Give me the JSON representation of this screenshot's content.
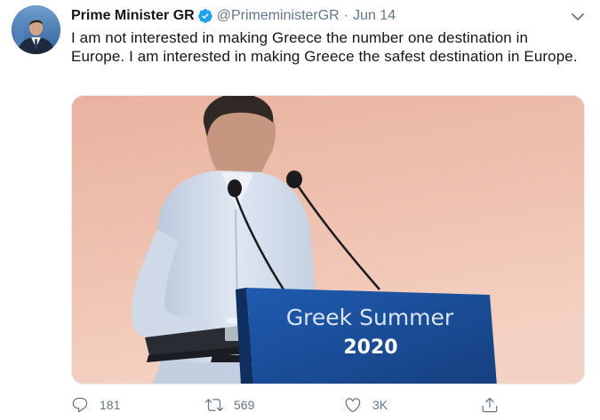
{
  "author": {
    "display_name": "Prime Minister GR",
    "handle": "@PrimeministerGR",
    "separator": "·",
    "date": "Jun 14",
    "verified": true
  },
  "tweet": {
    "text": "I am not interested in making Greece the number one destination in Europe. I am interested in making Greece the safest destination in Europe."
  },
  "media": {
    "podium_line1": "Greek Summer",
    "podium_line2": "2020"
  },
  "actions": {
    "reply_count": "181",
    "retweet_count": "569",
    "like_count": "3K"
  },
  "icons": {
    "reply": "reply-icon",
    "retweet": "retweet-icon",
    "like": "heart-icon",
    "share": "share-icon",
    "verified": "verified-badge-icon",
    "caret": "chevron-down-icon"
  },
  "colors": {
    "text": "#14171a",
    "muted": "#657786",
    "verified": "#1da1f2",
    "podium": "#1a4f9e"
  }
}
